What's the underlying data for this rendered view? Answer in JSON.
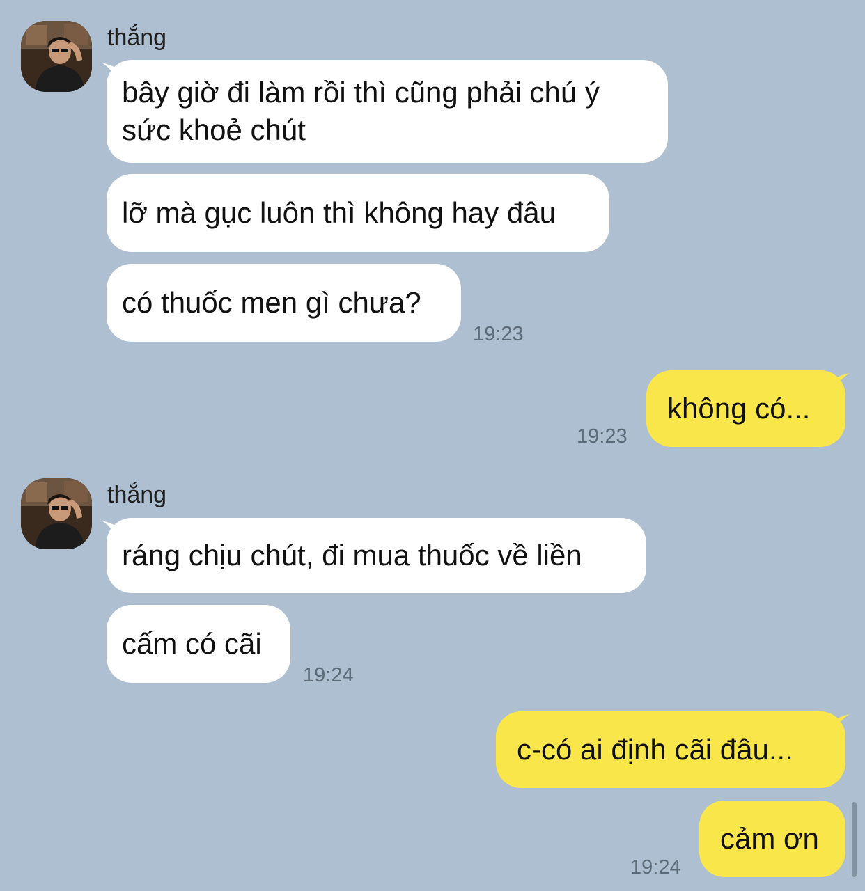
{
  "conversation": {
    "groups": [
      {
        "sender": "thắng",
        "messages": [
          "bây giờ đi làm rồi thì cũng phải chú ý\nsức khoẻ chút",
          "lỡ mà gục luôn thì không hay đâu",
          "có thuốc men gì chưa?"
        ],
        "time": "19:23"
      },
      {
        "self": true,
        "messages": [
          "không có..."
        ],
        "time": "19:23"
      },
      {
        "sender": "thắng",
        "messages": [
          "ráng chịu chút, đi mua thuốc về liền",
          "cấm có cãi"
        ],
        "time": "19:24"
      },
      {
        "self": true,
        "messages": [
          "c-có ai định cãi đâu...",
          "cảm ơn"
        ],
        "time": "19:24"
      }
    ]
  },
  "colors": {
    "background": "#adbfd0",
    "incoming_bubble": "#ffffff",
    "outgoing_bubble": "#f9e64a",
    "timestamp": "#5d6a78"
  },
  "icons": {
    "avatar": "user-avatar-photo"
  }
}
